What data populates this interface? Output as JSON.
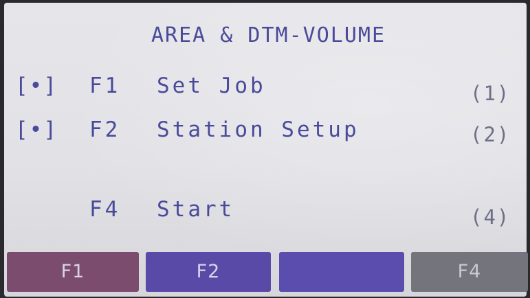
{
  "header": {
    "title": "AREA & DTM-VOLUME"
  },
  "menu": {
    "items": [
      {
        "mark": "[•]",
        "key": "F1",
        "label": "Set Job",
        "step": "(1)"
      },
      {
        "mark": "[•]",
        "key": "F2",
        "label": "Station Setup",
        "step": "(2)"
      },
      {
        "mark": "",
        "key": "F4",
        "label": "Start",
        "step": "(4)"
      }
    ]
  },
  "softkeys": {
    "f1": "F1",
    "f2": "F2",
    "f3": "",
    "f4": "F4"
  },
  "colors": {
    "text": "#4a4a9a",
    "background": "#e3e3e8",
    "softkey_f1": "#7b4c6e",
    "softkey_f2": "#5a4aa8",
    "softkey_f3": "#5b4dad",
    "softkey_f4": "#74757c"
  }
}
